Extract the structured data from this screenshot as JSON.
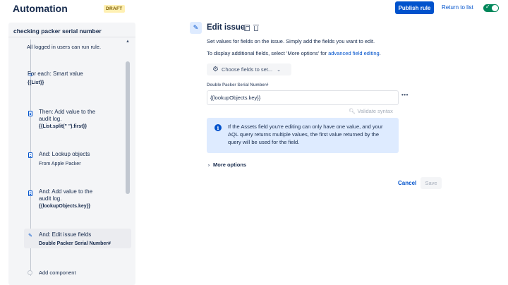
{
  "header": {
    "title": "Automation",
    "status_badge": "DRAFT",
    "publish_label": "Publish rule",
    "return_label": "Return to list",
    "rule_enabled": true
  },
  "sidebar": {
    "rule_name": "checking packer serial number",
    "trigger_note": "All logged in users can run rule.",
    "components": [
      {
        "icon": "branch-icon",
        "title": "For each: Smart value",
        "sub": "{{List}}"
      },
      {
        "icon": "document-icon",
        "title_lines": [
          "Then: Add value to the",
          "audit log."
        ],
        "sub": "{{List.split(\" \").first}}"
      },
      {
        "icon": "lookup-icon",
        "title": "And: Lookup objects",
        "sub": "From Apple Packer"
      },
      {
        "icon": "document-icon",
        "title_lines": [
          "And: Add value to the",
          "audit log."
        ],
        "sub": "{{lookupObjects.key}}"
      },
      {
        "icon": "pencil-icon",
        "title": "And: Edit issue fields",
        "sub": "Double Packer Serial Number#",
        "selected": true
      }
    ],
    "add_component_label": "Add component"
  },
  "main": {
    "title": "Edit issue",
    "description": "Set values for fields on the issue. Simply add the fields you want to edit.",
    "more_info_prefix": "To display additional fields, select 'More options' for ",
    "more_info_link": "advanced field editing",
    "more_info_suffix": ".",
    "choose_fields_label": "Choose fields to set...",
    "field_label": "Double Packer Serial Number#",
    "field_value": "{{lookupObjects.key}}",
    "validate_label": "Validate syntax",
    "info_message": "If the Assets field you're editing can only have one value, and your AQL query returns multiple values, the first value returned by the query will be used for the field.",
    "more_options_label": "More options",
    "cancel_label": "Cancel",
    "save_label": "Save"
  },
  "colors": {
    "accent": "#0052cc",
    "toggle_on": "#00875a",
    "draft_badge_bg": "#fff0b3",
    "info_bg": "#deebff",
    "sidebar_bg": "#f4f5f7"
  }
}
